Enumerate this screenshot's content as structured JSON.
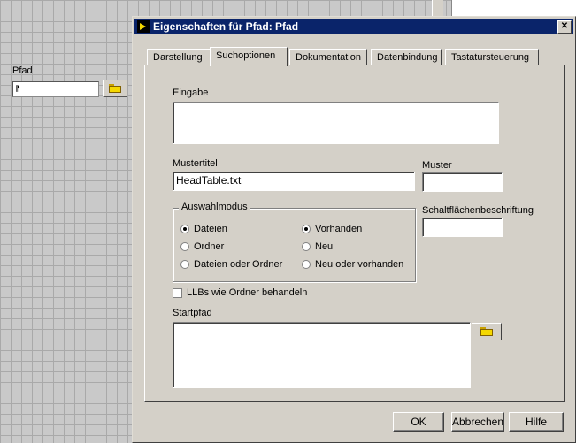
{
  "front_panel": {
    "control_label": "Pfad",
    "path_value": ""
  },
  "dialog": {
    "title": "Eigenschaften für Pfad: Pfad",
    "close_label": "✕",
    "tabs": [
      {
        "label": "Darstellung"
      },
      {
        "label": "Suchoptionen"
      },
      {
        "label": "Dokumentation"
      },
      {
        "label": "Datenbindung"
      },
      {
        "label": "Tastatursteuerung"
      }
    ],
    "active_tab": "Suchoptionen",
    "eingabe": {
      "label": "Eingabe",
      "value": ""
    },
    "mustertitel": {
      "label": "Mustertitel",
      "value": "HeadTable.txt"
    },
    "muster": {
      "label": "Muster",
      "value": ""
    },
    "schaltflaechen": {
      "label": "Schaltflächenbeschriftung",
      "value": ""
    },
    "auswahlmodus": {
      "label": "Auswahlmodus",
      "left_options": [
        {
          "label": "Dateien",
          "selected": true
        },
        {
          "label": "Ordner",
          "selected": false
        },
        {
          "label": "Dateien oder Ordner",
          "selected": false
        }
      ],
      "right_options": [
        {
          "label": "Vorhanden",
          "selected": true
        },
        {
          "label": "Neu",
          "selected": false
        },
        {
          "label": "Neu oder vorhanden",
          "selected": false
        }
      ]
    },
    "llb_checkbox": {
      "label": "LLBs wie Ordner behandeln",
      "checked": false
    },
    "startpfad": {
      "label": "Startpfad",
      "value": ""
    },
    "buttons": {
      "ok": "OK",
      "cancel": "Abbrechen",
      "help": "Hilfe"
    }
  }
}
